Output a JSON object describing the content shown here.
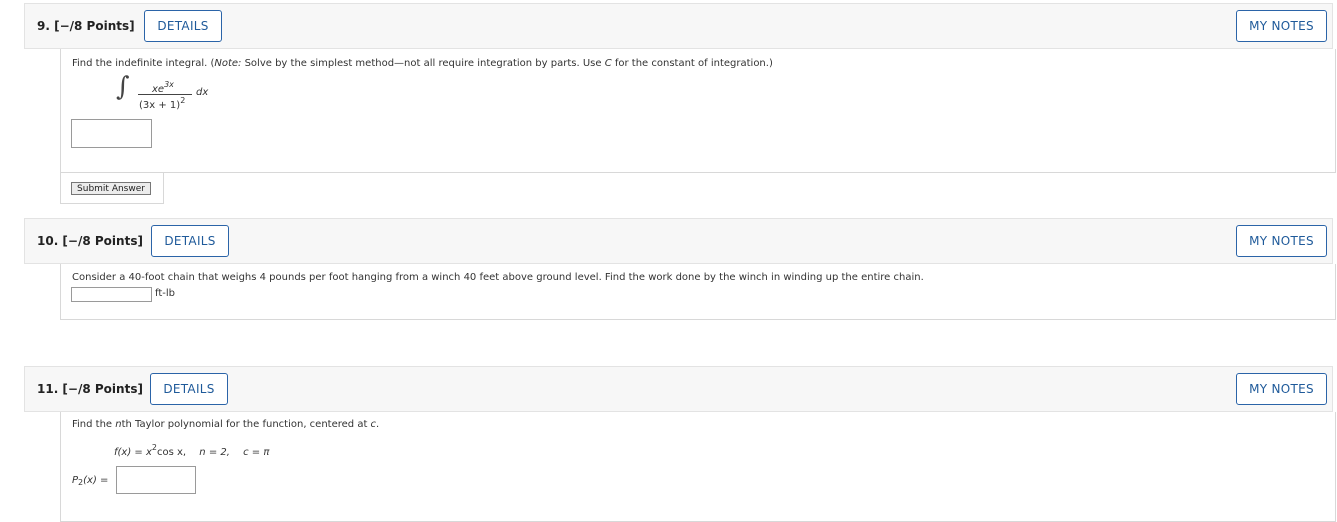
{
  "q9": {
    "title": "9. [−/8 Points]",
    "details": "DETAILS",
    "notes": "MY NOTES",
    "prompt_pre": "Find the indefinite integral. (",
    "note_label": "Note:",
    "prompt_mid": " Solve by the simplest method—not all require integration by parts. Use ",
    "const_var": "C",
    "prompt_post": " for the constant of integration.)",
    "integral_sign": "∫",
    "num_base": "xe",
    "num_exp": "3x",
    "den_base": "(3x + 1)",
    "den_exp": "2",
    "dx": "dx",
    "submit": "Submit Answer"
  },
  "q10": {
    "title": "10. [−/8 Points]",
    "details": "DETAILS",
    "notes": "MY NOTES",
    "prompt": "Consider a 40-foot chain that weighs 4 pounds per foot hanging from a winch 40 feet above ground level. Find the work done by the winch in winding up the entire chain.",
    "unit": "ft-lb"
  },
  "q11": {
    "title": "11. [−/8 Points]",
    "details": "DETAILS",
    "notes": "MY NOTES",
    "prompt_pre": "Find the ",
    "prompt_n": "n",
    "prompt_mid": "th Taylor polynomial for the function, centered at ",
    "prompt_c": "c",
    "prompt_post": ".",
    "func_lhs": "f(x) = x",
    "func_exp": "2",
    "func_rhs": "cos x,",
    "n_expr": "n = 2,",
    "c_expr": "c = π",
    "answer_label_p": "P",
    "answer_label_sub": "2",
    "answer_label_rest": "(x) ="
  }
}
